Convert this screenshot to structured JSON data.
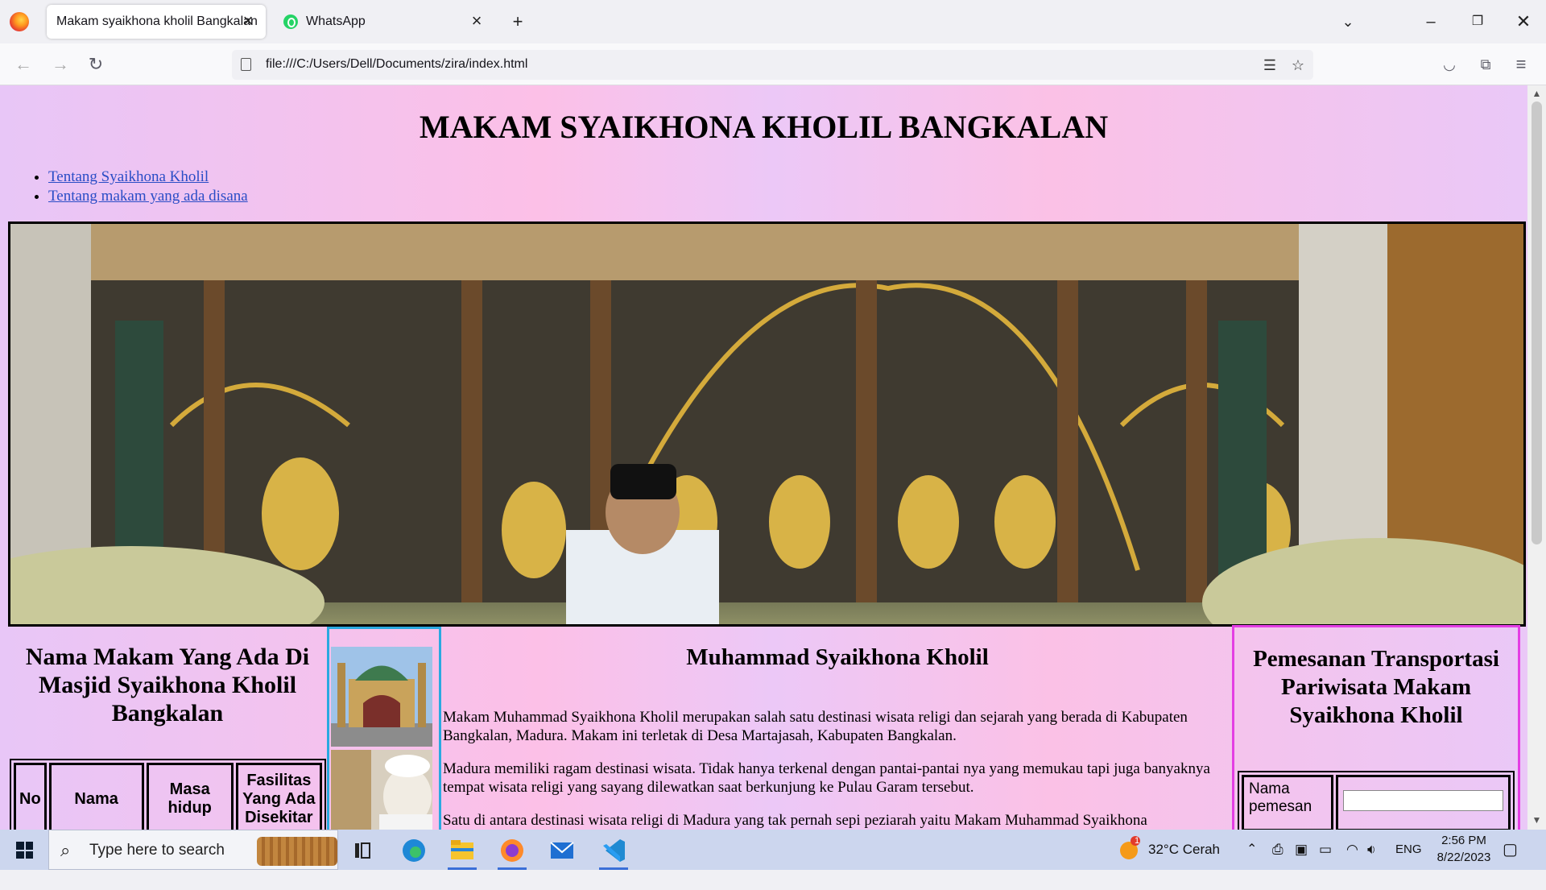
{
  "browser": {
    "tabs": [
      {
        "label": "Makam syaikhona kholil Bangkalan",
        "active": true
      },
      {
        "label": "WhatsApp",
        "active": false
      }
    ],
    "url": "file:///C:/Users/Dell/Documents/zira/index.html",
    "icons": [
      "firefox-icon",
      "close-icon",
      "whatsapp-icon",
      "plus-icon",
      "chevron-down-icon",
      "minimize-icon",
      "restore-icon",
      "close-window-icon",
      "back-icon",
      "forward-icon",
      "reload-icon",
      "page-icon",
      "reader-view-icon",
      "star-icon",
      "pocket-icon",
      "extensions-icon",
      "menu-icon"
    ]
  },
  "page": {
    "heading": "MAKAM SYAIKHONA KHOLIL BANGKALAN",
    "links": [
      "Tentang Syaikhona Kholil",
      "Tentang makam yang ada disana"
    ],
    "left": {
      "title": "Nama Makam Yang Ada Di Masjid Syaikhona Kholil Bangkalan",
      "table_headers": [
        "No",
        "Nama",
        "Masa hidup",
        "Fasilitas Yang Ada Disekitar"
      ]
    },
    "main": {
      "title": "Muhammad Syaikhona Kholil",
      "paragraphs": [
        "Makam Muhammad Syaikhona Kholil merupakan salah satu destinasi wisata religi dan sejarah yang berada di Kabupaten Bangkalan, Madura. Makam ini terletak di Desa Martajasah, Kabupaten Bangkalan.",
        "Madura memiliki ragam destinasi wisata. Tidak hanya terkenal dengan pantai-pantai nya yang memukau tapi juga banyaknya tempat wisata religi yang sayang dilewatkan saat berkunjung ke Pulau Garam tersebut.",
        "Satu di antara destinasi wisata religi di Madura yang tak pernah sepi peziarah yaitu Makam Muhammad Syaikhona"
      ]
    },
    "right": {
      "title": "Pemesanan Transportasi Pariwisata Makam Syaikhona Kholil",
      "form_label": "Nama pemesan",
      "form_value": ""
    }
  },
  "taskbar": {
    "search_placeholder": "Type here to search",
    "weather": "32°C Cerah",
    "weather_badge": "1",
    "language": "ENG",
    "time": "2:56 PM",
    "date": "8/22/2023"
  }
}
